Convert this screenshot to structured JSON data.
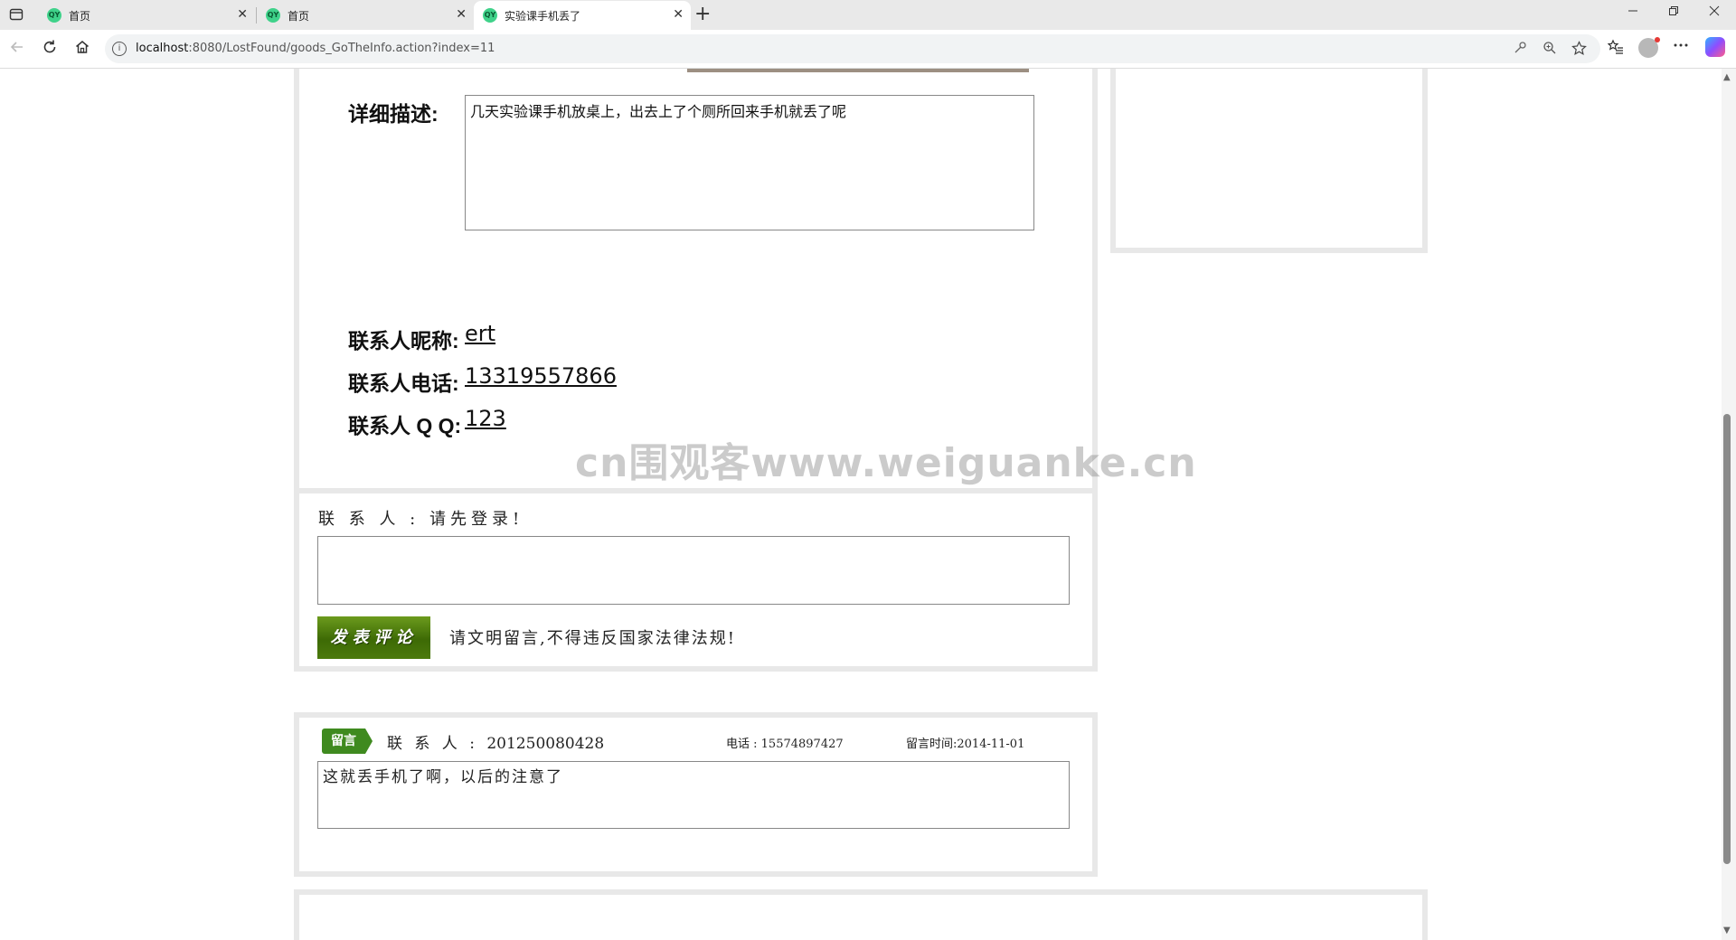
{
  "browser": {
    "tabs": [
      {
        "label": "首页",
        "favicon": "QY"
      },
      {
        "label": "首页",
        "favicon": "QY"
      },
      {
        "label": "实验课手机丢了",
        "favicon": "QY"
      }
    ],
    "url_host": "localhost",
    "url_rest": ":8080/LostFound/goods_GoTheInfo.action?index=11",
    "tab_close": "✕",
    "new_tab": "+"
  },
  "item": {
    "description_label": "详细描述:",
    "description": "几天实验课手机放桌上，出去上了个厕所回来手机就丢了呢",
    "nickname_label": "联系人昵称:",
    "nickname": "ert",
    "phone_label": "联系人电话:",
    "phone": "13319557866",
    "qq_label": "联系人 Q Q:",
    "qq": "123"
  },
  "comment_form": {
    "contact_prefix": "联 系 人 :",
    "contact_value": "请先登录!",
    "submit_label": "发表评论",
    "notice": "请文明留言,不得违反国家法律法规!"
  },
  "messages": [
    {
      "tag": "留言",
      "contact_prefix": "联 系 人 :",
      "contact": "201250080428",
      "phone_label": "电话 :",
      "phone": "15574897427",
      "time_label": "留言时间:",
      "time": "2014-11-01",
      "content": "这就丢手机了啊，以后的注意了"
    }
  ],
  "watermark": "cn围观客www.weiguanke.cn",
  "colors": {
    "panel_border": "#e8e8e8",
    "button_green": "#4c7a0d",
    "tag_green": "#3f8a1f"
  }
}
